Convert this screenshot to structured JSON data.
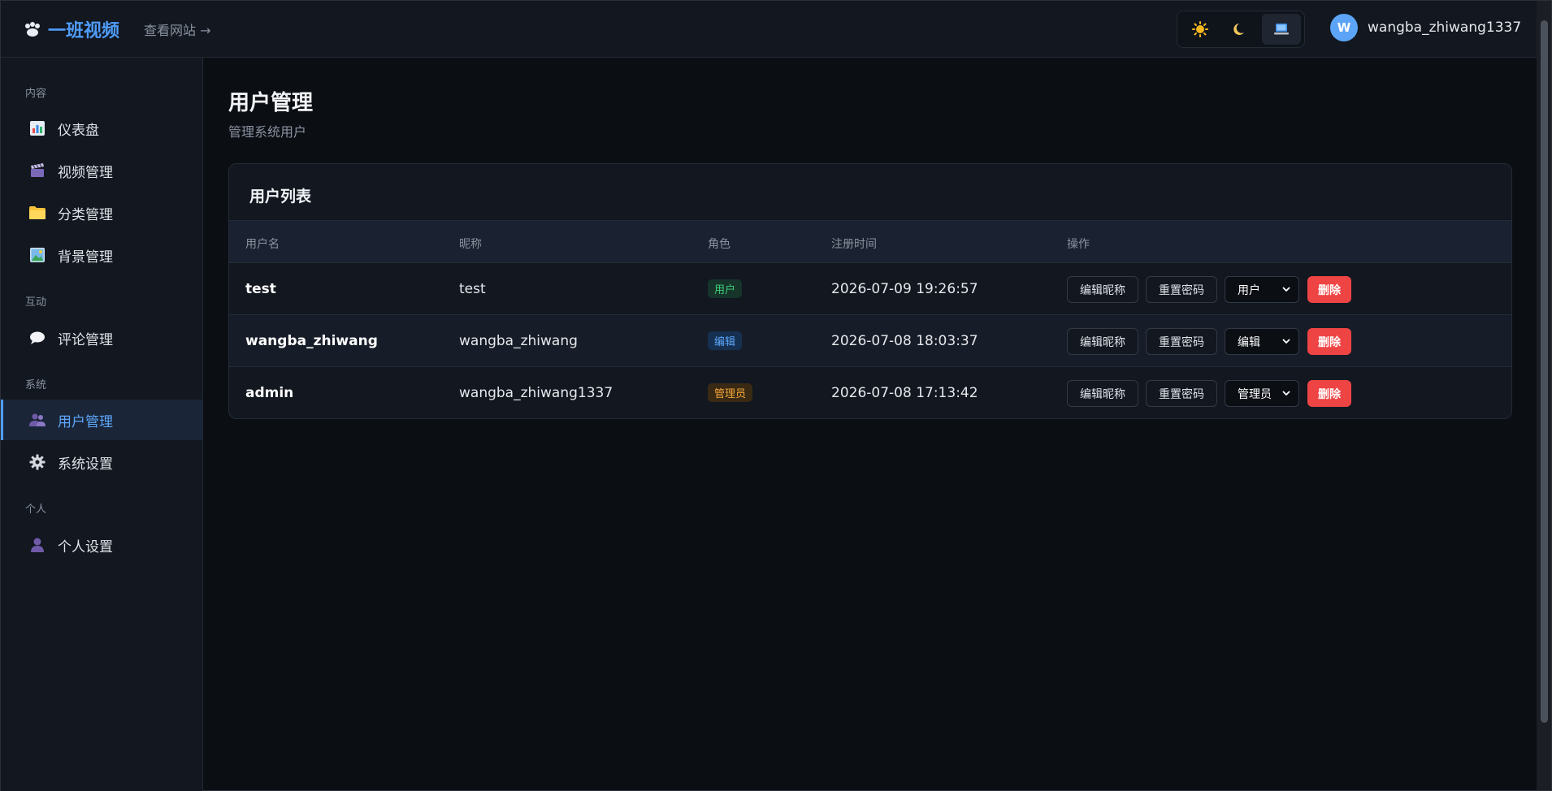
{
  "header": {
    "brand_name": "一班视频",
    "view_site": "查看网站 →",
    "user": {
      "avatar_letter": "W",
      "name": "wangba_zhiwang1337"
    },
    "theme": {
      "active": "system"
    }
  },
  "sidebar": {
    "sections": [
      {
        "title": "内容",
        "items": [
          {
            "label": "仪表盘",
            "icon": "bar-chart-icon"
          },
          {
            "label": "视频管理",
            "icon": "clapper-icon"
          },
          {
            "label": "分类管理",
            "icon": "folder-icon"
          },
          {
            "label": "背景管理",
            "icon": "image-icon"
          }
        ]
      },
      {
        "title": "互动",
        "items": [
          {
            "label": "评论管理",
            "icon": "speech-bubble-icon"
          }
        ]
      },
      {
        "title": "系统",
        "items": [
          {
            "label": "用户管理",
            "icon": "users-icon",
            "active": true
          },
          {
            "label": "系统设置",
            "icon": "gear-icon"
          }
        ]
      },
      {
        "title": "个人",
        "items": [
          {
            "label": "个人设置",
            "icon": "person-icon"
          }
        ]
      }
    ]
  },
  "main": {
    "title": "用户管理",
    "subtitle": "管理系统用户",
    "card_title": "用户列表",
    "columns": [
      "用户名",
      "昵称",
      "角色",
      "注册时间",
      "操作"
    ],
    "rows": [
      {
        "username": "test",
        "nickname": "test",
        "role": "用户",
        "registered": "2026-07-09 19:26:57",
        "role_select": "用户"
      },
      {
        "username": "wangba_zhiwang",
        "nickname": "wangba_zhiwang",
        "role": "编辑",
        "registered": "2026-07-08 18:03:37",
        "role_select": "编辑"
      },
      {
        "username": "admin",
        "nickname": "wangba_zhiwang1337",
        "role": "管理员",
        "registered": "2026-07-08 17:13:42",
        "role_select": "管理员"
      }
    ],
    "actions": {
      "edit_nickname": "编辑昵称",
      "reset_password": "重置密码",
      "delete": "删除"
    }
  },
  "colors": {
    "accent": "#4f9cf9",
    "danger": "#ef4444",
    "role_user": "#3fcf7a",
    "role_editor": "#5ea6fb",
    "role_admin": "#f2a53a"
  }
}
